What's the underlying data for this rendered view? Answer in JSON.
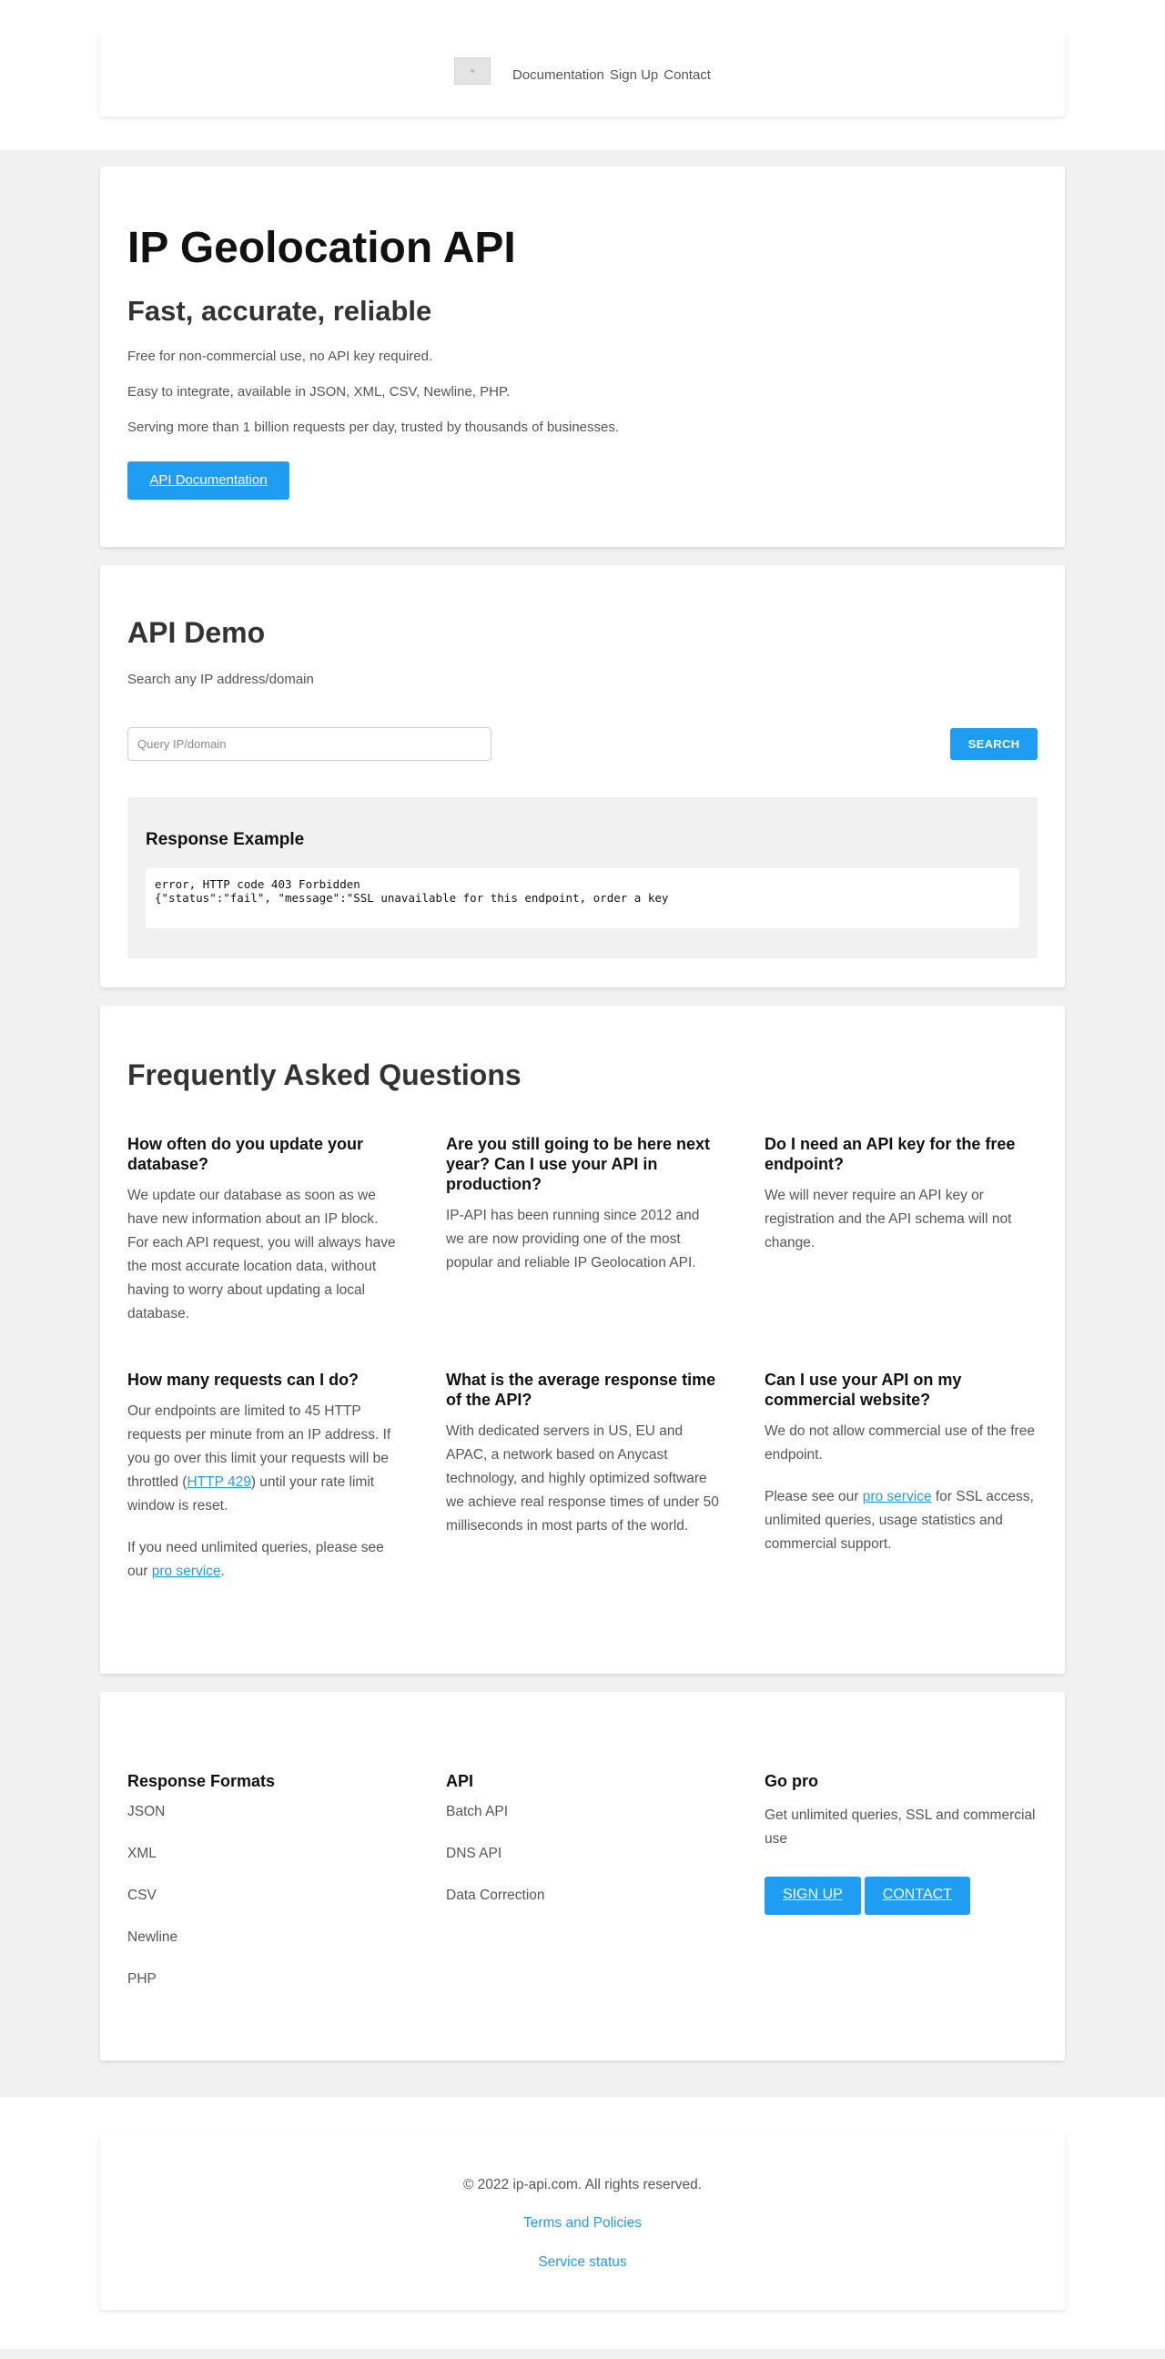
{
  "nav": {
    "links": [
      "Documentation",
      "Sign Up",
      "Contact"
    ]
  },
  "hero": {
    "title": "IP Geolocation API",
    "subtitle": "Fast, accurate, reliable",
    "lines": [
      "Free for non-commercial use, no API key required.",
      "Easy to integrate, available in JSON, XML, CSV, Newline, PHP.",
      "Serving more than 1 billion requests per day, trusted by thousands of businesses."
    ],
    "cta_label": "API Documentation"
  },
  "demo": {
    "title": "API Demo",
    "subtitle": "Search any IP address/domain",
    "search_placeholder": "Query IP/domain",
    "search_value": "",
    "search_button": "SEARCH",
    "response_title": "Response Example",
    "response_lines": [
      "error, HTTP code 403 Forbidden",
      "{\"status\":\"fail\", \"message\":\"SSL unavailable for this endpoint, order a key"
    ]
  },
  "faq": {
    "title": "Frequently Asked Questions",
    "items": [
      {
        "question": "How often do you update your database?",
        "answer": "We update our database as soon as we have new information about an IP block. For each API request, you will always have the most accurate location data, without having to worry about updating a local database."
      },
      {
        "question": "Are you still going to be here next year? Can I use your API in production?",
        "answer": "IP-API has been running since 2012 and we are now providing one of the most popular and reliable IP Geolocation API."
      },
      {
        "question": "Do I need an API key for the free endpoint?",
        "answer": "We will never require an API key or registration and the API schema will not change."
      },
      {
        "question": "How many requests can I do?",
        "answer_before_link": "Our endpoints are limited to 45 HTTP requests per minute from an IP address. If you go over this limit your requests will be throttled (",
        "answer_link": "HTTP 429",
        "answer_after_link": ") until your rate limit window is reset.",
        "answer2_before_link": "If you need unlimited queries, please see our ",
        "answer2_link": "pro service",
        "answer2_after_link": "."
      },
      {
        "question": "What is the average response time of the API?",
        "answer": "With dedicated servers in US, EU and APAC, a network based on Anycast technology, and highly optimized software we achieve real response times of under 50 milliseconds in most parts of the world."
      },
      {
        "question": "Can I use your API on my commercial website?",
        "answer": "We do not allow commercial use of the free endpoint.",
        "answer2_before_link": "Please see our ",
        "answer2_link": "pro service",
        "answer2_after_link": " for SSL access, unlimited queries, usage statistics and commercial support."
      }
    ]
  },
  "footer": {
    "formats": {
      "title": "Response Formats",
      "items": [
        "JSON",
        "XML",
        "CSV",
        "Newline",
        "PHP"
      ]
    },
    "api": {
      "title": "API",
      "items": [
        "Batch API",
        "DNS API",
        "Data Correction"
      ]
    },
    "gopro": {
      "title": "Go pro",
      "text": "Get unlimited queries, SSL and commercial use",
      "signup_label": "SIGN UP",
      "contact_label": "CONTACT"
    },
    "copyright": "© 2022 ip-api.com. All rights reserved.",
    "terms_label": "Terms and Policies",
    "status_label": "Service status"
  },
  "colors": {
    "accent": "#1e9df2",
    "page_bg": "#f1f1f1",
    "card_bg": "#ffffff"
  }
}
